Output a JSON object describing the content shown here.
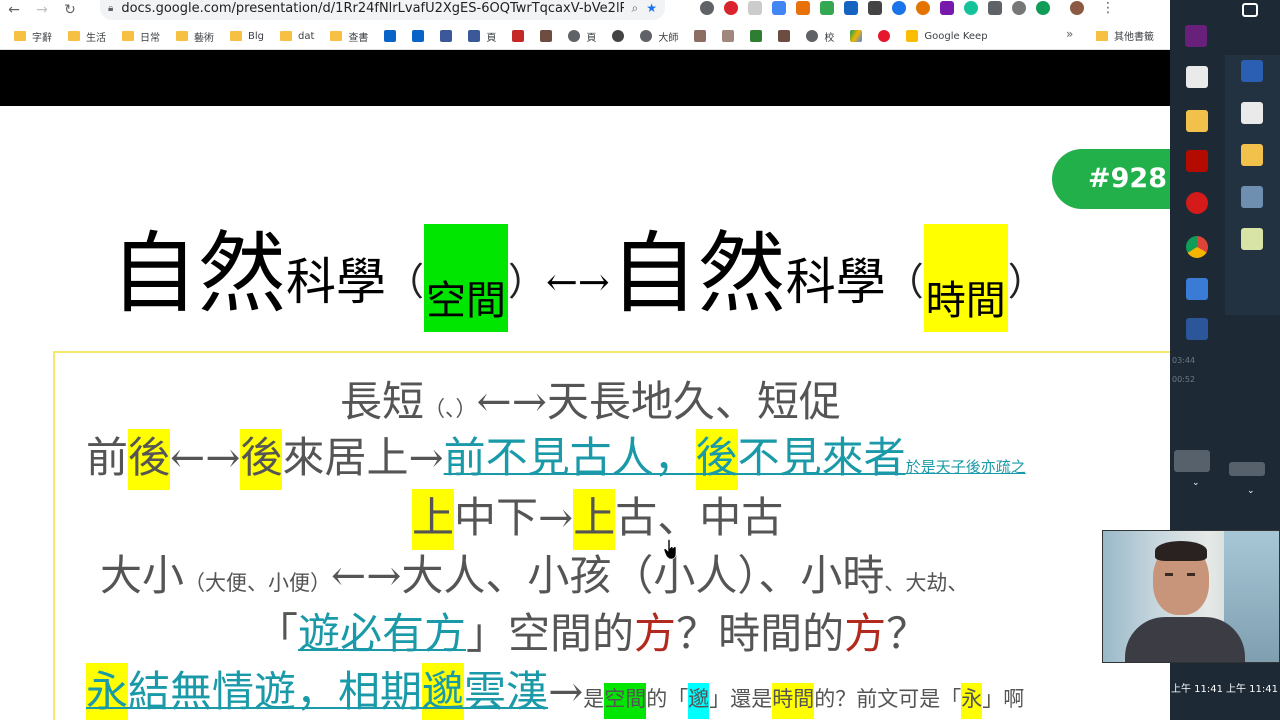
{
  "browser": {
    "url": "docs.google.com/presentation/d/1Rr24fNlrLvafU2XgES-6OQTwrTqcaxV-bVe2lPmO...",
    "bookmarks": [
      "字辭",
      "生活",
      "日常",
      "藝術",
      "Blg",
      "dat",
      "查書",
      "",
      "",
      "",
      "頁",
      "",
      "",
      "頁",
      "大師",
      "",
      "",
      "",
      "",
      "校",
      "",
      "",
      "Google Keep"
    ],
    "other_bookmarks": "其他書籤",
    "more": "»"
  },
  "slide": {
    "badge": "#928",
    "title": {
      "big1": "自然",
      "med1": "科學",
      "paren_open": "（",
      "box1": "空間",
      "paren_close": "）",
      "arrow": "←→",
      "big2": "自然",
      "med2": "科學",
      "box2": "時間"
    },
    "line1": {
      "a": "長短",
      "b": "（、）",
      "c": "←→天長地久、短促"
    },
    "line2": {
      "a": "前",
      "b": "後",
      "c": "←→",
      "d": "後",
      "e": "來居上→",
      "f": "前不見古人，",
      "g": "後",
      "h": "不見來者",
      "i": "於是天子後亦疏之"
    },
    "line3": {
      "a": "上",
      "b": "中下→",
      "c": "上",
      "d": "古、中古"
    },
    "line4": {
      "a": "大小",
      "b": "（大便、小便）",
      "c": "←→大人、小孩（小人）、小時",
      "d": "、大劫、"
    },
    "line5": {
      "a": "「",
      "b": "遊必有方",
      "c": "」空間的",
      "d": "方",
      "e": "？時間的",
      "f": "方",
      "g": "？"
    },
    "line6": {
      "a": "永",
      "b": "結無情遊，相期",
      "c": "邈",
      "d": "雲漢",
      "e": "→",
      "f": "是",
      "g": "空間",
      "h": "的「",
      "i": "邈",
      "j": "」還是",
      "k": "時間",
      "l": "的？前文可是「",
      "m": "永",
      "n": "」啊"
    }
  },
  "taskbar": {
    "clock1": "上午 11:41",
    "clock2": "上午 11:41",
    "times": [
      "03:44",
      "00:52"
    ]
  },
  "colors": {
    "green_highlight": "#00e600",
    "yellow_highlight": "#ffff00",
    "cyan_highlight": "#00ffff",
    "link": "#1a9aa8",
    "badge": "#22b04b",
    "red_text": "#b22a1e"
  }
}
